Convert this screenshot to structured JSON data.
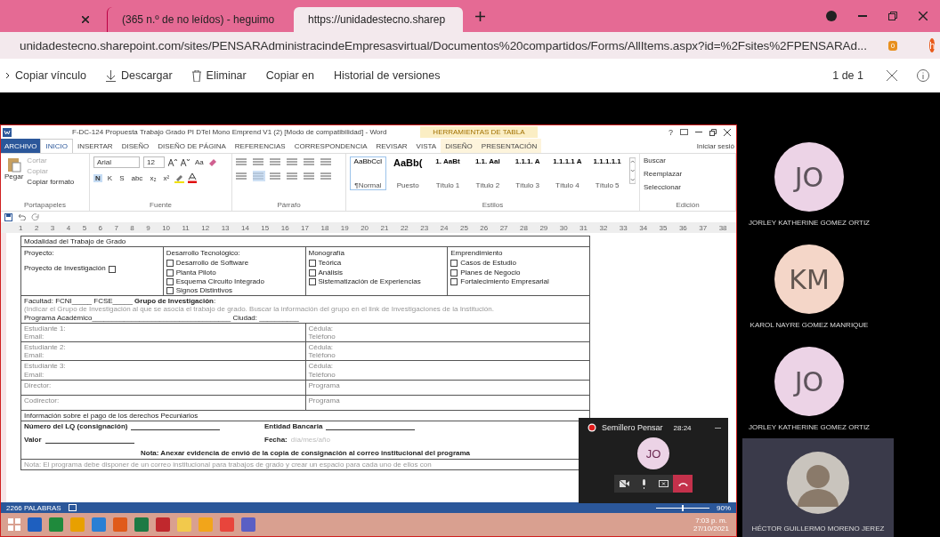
{
  "browser": {
    "tabs": [
      {
        "kind": "partial",
        "selected": false
      },
      {
        "kind": "mail",
        "title": "(365 n.º de no leídos) - heguimo",
        "selected": false
      },
      {
        "kind": "site",
        "title": "https://unidadestecno.sharep",
        "selected": true,
        "audio": true
      }
    ],
    "address": {
      "url": "unidadestecno.sharepoint.com/sites/PENSARAdministracindeEmpresasvirtual/Documentos%20compartidos/Forms/AllItems.aspx?id=%2Fsites%2FPENSARAd...",
      "extension_badge": "0",
      "profile_initial": "h"
    }
  },
  "viewer_toolbar": {
    "actions": [
      {
        "kind": "link",
        "label": "Copiar vínculo"
      },
      {
        "kind": "download",
        "label": "Descargar"
      },
      {
        "kind": "delete",
        "label": "Eliminar"
      },
      {
        "kind": "plain",
        "label": "Copiar en"
      },
      {
        "kind": "plain",
        "label": "Historial de versiones"
      }
    ],
    "page_counter": "1 de 1"
  },
  "word": {
    "title": "F-DC-124 Propuesta Trabajo Grado PI DTel Mono Emprend V1 (2) [Modo de compatibilidad] - Word",
    "context_group": "HERRAMIENTAS DE TABLA",
    "help": "?",
    "sign_in": "Iniciar sesió",
    "tabs": [
      {
        "label": "ARCHIVO",
        "kind": "file",
        "selected": false
      },
      {
        "label": "INICIO",
        "kind": "normal",
        "selected": true
      },
      {
        "label": "INSERTAR",
        "kind": "normal",
        "selected": false
      },
      {
        "label": "DISEÑO",
        "kind": "normal",
        "selected": false
      },
      {
        "label": "DISEÑO DE PÁGINA",
        "kind": "normal",
        "selected": false
      },
      {
        "label": "REFERENCIAS",
        "kind": "normal",
        "selected": false
      },
      {
        "label": "CORRESPONDENCIA",
        "kind": "normal",
        "selected": false
      },
      {
        "label": "REVISAR",
        "kind": "normal",
        "selected": false
      },
      {
        "label": "VISTA",
        "kind": "normal",
        "selected": false
      },
      {
        "label": "DISEÑO",
        "kind": "context",
        "selected": false
      },
      {
        "label": "PRESENTACIÓN",
        "kind": "context",
        "selected": false
      }
    ],
    "clipboard": {
      "paste": "Pegar",
      "items": [
        "Cortar",
        "Copiar",
        "Copiar formato"
      ],
      "label": "Portapapeles"
    },
    "font": {
      "family": "Arial",
      "size": "12",
      "case_button": "Aa",
      "format_buttons": [
        "N",
        "K",
        "S",
        "abc",
        "x₂",
        "x²"
      ],
      "label": "Fuente"
    },
    "paragraph": {
      "label": "Párrafo"
    },
    "styles": {
      "label": "Estilos",
      "items": [
        {
          "preview": "AaBbCcI",
          "name": "¶Normal",
          "selected": true
        },
        {
          "preview": "AaBb(",
          "name": "Puesto",
          "selected": false
        },
        {
          "preview": "1. AaBt",
          "name": "Título 1",
          "selected": false
        },
        {
          "preview": "1.1. Aal",
          "name": "Título 2",
          "selected": false
        },
        {
          "preview": "1.1.1. A",
          "name": "Título 3",
          "selected": false
        },
        {
          "preview": "1.1.1.1 A",
          "name": "Título 4",
          "selected": false
        },
        {
          "preview": "1.1.1.1.1",
          "name": "Título 5",
          "selected": false
        }
      ]
    },
    "editing": {
      "label": "Edición",
      "items": [
        "Buscar",
        "Reemplazar",
        "Seleccionar"
      ]
    },
    "ruler": [
      "1",
      "2",
      "3",
      "4",
      "5",
      "6",
      "7",
      "8",
      "9",
      "10",
      "11",
      "12",
      "13",
      "14",
      "15",
      "16",
      "17",
      "18",
      "19",
      "20",
      "21",
      "22",
      "23",
      "24",
      "25",
      "26",
      "27",
      "28",
      "29",
      "30",
      "31",
      "32",
      "33",
      "34",
      "35",
      "36",
      "37",
      "38"
    ],
    "document": {
      "section_title": "Modalidad del Trabajo de Grado",
      "modalities": [
        {
          "title": "Proyecto:",
          "options": [
            {
              "label": "Proyecto de Investigación",
              "checked": false
            }
          ]
        },
        {
          "title": "Desarrollo  Tecnológico:",
          "options": [
            {
              "label": "Desarrollo de Software",
              "checked": false
            },
            {
              "label": "Planta Piloto",
              "checked": false
            },
            {
              "label": "Esquema Circuito Integrado",
              "checked": false
            },
            {
              "label": "Signos Distintivos",
              "checked": false
            }
          ]
        },
        {
          "title": "Monografía",
          "options": [
            {
              "label": "Teórica",
              "checked": false
            },
            {
              "label": "Análisis",
              "checked": false
            },
            {
              "label": "Sistematización de Experiencias",
              "checked": false
            }
          ]
        },
        {
          "title": "Emprendimiento",
          "options": [
            {
              "label": "Casos de Estudio",
              "checked": false
            },
            {
              "label": "Planes de Negocio",
              "checked": false
            },
            {
              "label": "Fortalecimiento Empresarial",
              "checked": false
            }
          ]
        }
      ],
      "faculty_line": "Facultad: FCNI_____     FCSE_____    **Grupo de Investigación**:",
      "faculty_hint": "(Indicar el Grupo de Investigación al que se asocia el trabajo de grado. Buscar la información del grupo en el link de Investigaciones de la Institución.",
      "program_line": "Programa Académico___________________________________ Ciudad: __________",
      "people": [
        {
          "left": [
            "Estudiante 1:",
            "Email:"
          ],
          "right": [
            "Cédula:",
            "Teléfono"
          ]
        },
        {
          "left": [
            "Estudiante 2:",
            "Email:"
          ],
          "right": [
            "Cédula:",
            "Teléfono"
          ]
        },
        {
          "left": [
            "Estudiante 3:",
            "Email:"
          ],
          "right": [
            "Cédula:",
            "Teléfono"
          ]
        },
        {
          "left": [
            "Director:"
          ],
          "right": [
            "Programa"
          ]
        },
        {
          "left": [
            "Codirector:"
          ],
          "right": [
            "Programa"
          ]
        }
      ],
      "payment_title": "Información sobre el pago de los derechos Pecuniarios",
      "payment_fields": [
        {
          "label": "Número del LQ (consignación)"
        },
        {
          "label": "Entidad Bancaria"
        },
        {
          "label": "Valor"
        },
        {
          "label": "Fecha:",
          "placeholder": "día/mes/año"
        }
      ],
      "note": "Nota: Anexar evidencia de envió de la copia de consignación al correo institucional del programa",
      "note_2": "Nota: El programa debe disponer de un correo institucional para trabajos de grado y crear un espacio para cada uno de ellos con"
    },
    "status_bar": {
      "words": "2266 PALABRAS",
      "zoom": {
        "label": "90%",
        "level": 0.5
      }
    }
  },
  "taskbar": {
    "time": "7:03 p. m.",
    "date": "27/10/2021"
  },
  "call": {
    "title": "Semillero Pensar",
    "duration": "28:24",
    "initials": "JO",
    "recording": true
  },
  "participants": [
    {
      "kind": "initials",
      "initials": "JO",
      "name": "JORLEY KATHERINE GOMEZ ORTIZ",
      "color": "#ecd3e6"
    },
    {
      "kind": "initials",
      "initials": "KM",
      "name": "KAROL NAYRE GOMEZ MANRIQUE",
      "color": "#f4d6c8"
    },
    {
      "kind": "initials",
      "initials": "JO",
      "name": "JORLEY KATHERINE GOMEZ ORTIZ",
      "color": "#ecd3e6"
    },
    {
      "kind": "photo",
      "name": "HÉCTOR GUILLERMO MORENO JEREZ",
      "color": "#3a3a4a"
    }
  ]
}
